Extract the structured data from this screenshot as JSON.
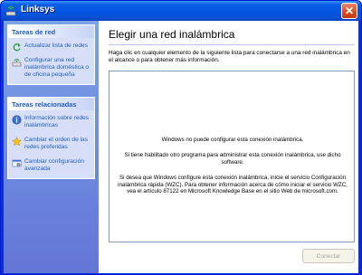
{
  "window": {
    "title": "Linksys"
  },
  "sidebar": {
    "network_tasks": {
      "header": "Tareas de red",
      "items": [
        {
          "label": "Actualizar lista de redes",
          "icon": "refresh-icon"
        },
        {
          "label": "Configurar una red inalámbrica doméstica o de oficina pequeña",
          "icon": "wireless-setup-icon"
        }
      ]
    },
    "related_tasks": {
      "header": "Tareas relacionadas",
      "items": [
        {
          "label": "Información sobre redes inalámbricas",
          "icon": "info-icon"
        },
        {
          "label": "Cambiar el orden de las redes preferidas",
          "icon": "star-icon"
        },
        {
          "label": "Cambiar configuración avanzada",
          "icon": "advanced-settings-icon"
        }
      ]
    }
  },
  "main": {
    "title": "Elegir una red inalámbrica",
    "instructions": "Haga clic en cualquier elemento de la siguiente lista para conectarse a una red inalámbrica en el alcance o para obtener más información.",
    "message_1": "Windows no puede configurar esta conexión inalámbrica.",
    "message_2": "Si tiene habilitado otro programa para administrar esta conexión inalámbrica, use dicho software.",
    "message_3": "Si desea que Windows configure esta conexión inalámbrica, inicie el servicio Configuración inalámbrica rápida (WZC). Para obtener información acerca de cómo iniciar el servicio WZC, vea el artículo 87122 en Microsoft Knowledge Base en el sitio Web de microsoft.com.",
    "connect_label": "Conectar"
  },
  "colors": {
    "titlebar": "#0a5fe6",
    "sidebar": "#6f8ee0",
    "panel": "#d6dff7",
    "link": "#215dc6",
    "close": "#d54b22"
  }
}
